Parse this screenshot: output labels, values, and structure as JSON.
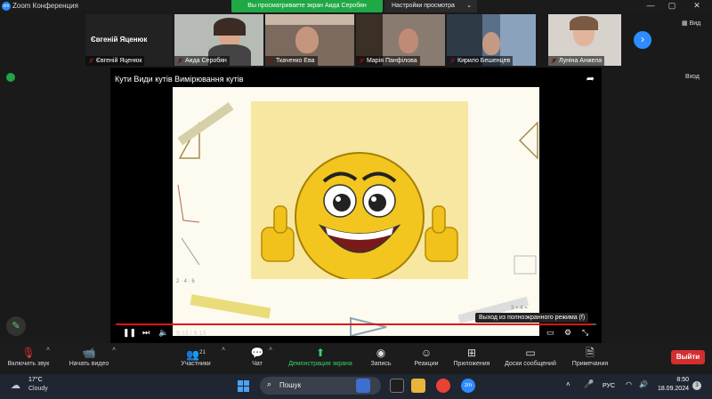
{
  "app": {
    "title": "Zoom Конференция",
    "icon": "zm"
  },
  "share_banner": "Вы просматриваете экран Аида Серобян",
  "view_options": "Настройки просмотра",
  "gallery": {
    "active_speaker": "Євгеній Яценюк",
    "tiles": [
      {
        "name": "Євгеній Яценюк"
      },
      {
        "name": "Аида Серобян"
      },
      {
        "name": "Ткаченко Ева"
      },
      {
        "name": "Марія Панфілова"
      },
      {
        "name": "Кирило Бешенцев"
      },
      {
        "name": "Луніна Анжела"
      }
    ],
    "view_label": "Вид"
  },
  "exit_label": "Вход",
  "video": {
    "title": "Кути Види кутів Вимірювання кутів",
    "time": "9:13 / 9:13",
    "progress": 0.99,
    "tooltip": "Выход из полноэкранного режима (f)"
  },
  "toolbar": {
    "audio": "Включить звук",
    "video": "Начать видео",
    "participants": "Участники",
    "participants_count": "21",
    "chat": "Чат",
    "share": "Демонстрация экрана",
    "record": "Запись",
    "reactions": "Реакции",
    "apps": "Приложения",
    "whiteboards": "Доски сообщений",
    "notes": "Примечания",
    "leave": "Выйти"
  },
  "taskbar": {
    "weather_temp": "17°C",
    "weather_cond": "Cloudy",
    "search": "Пошук",
    "lang": "РУС",
    "time": "8:50",
    "date": "18.09.2024",
    "notifications": "3"
  },
  "colors": {
    "accent": "#2d8cff",
    "share_green": "#20a845",
    "leave_red": "#d32f2f",
    "progress": "#e11111"
  }
}
